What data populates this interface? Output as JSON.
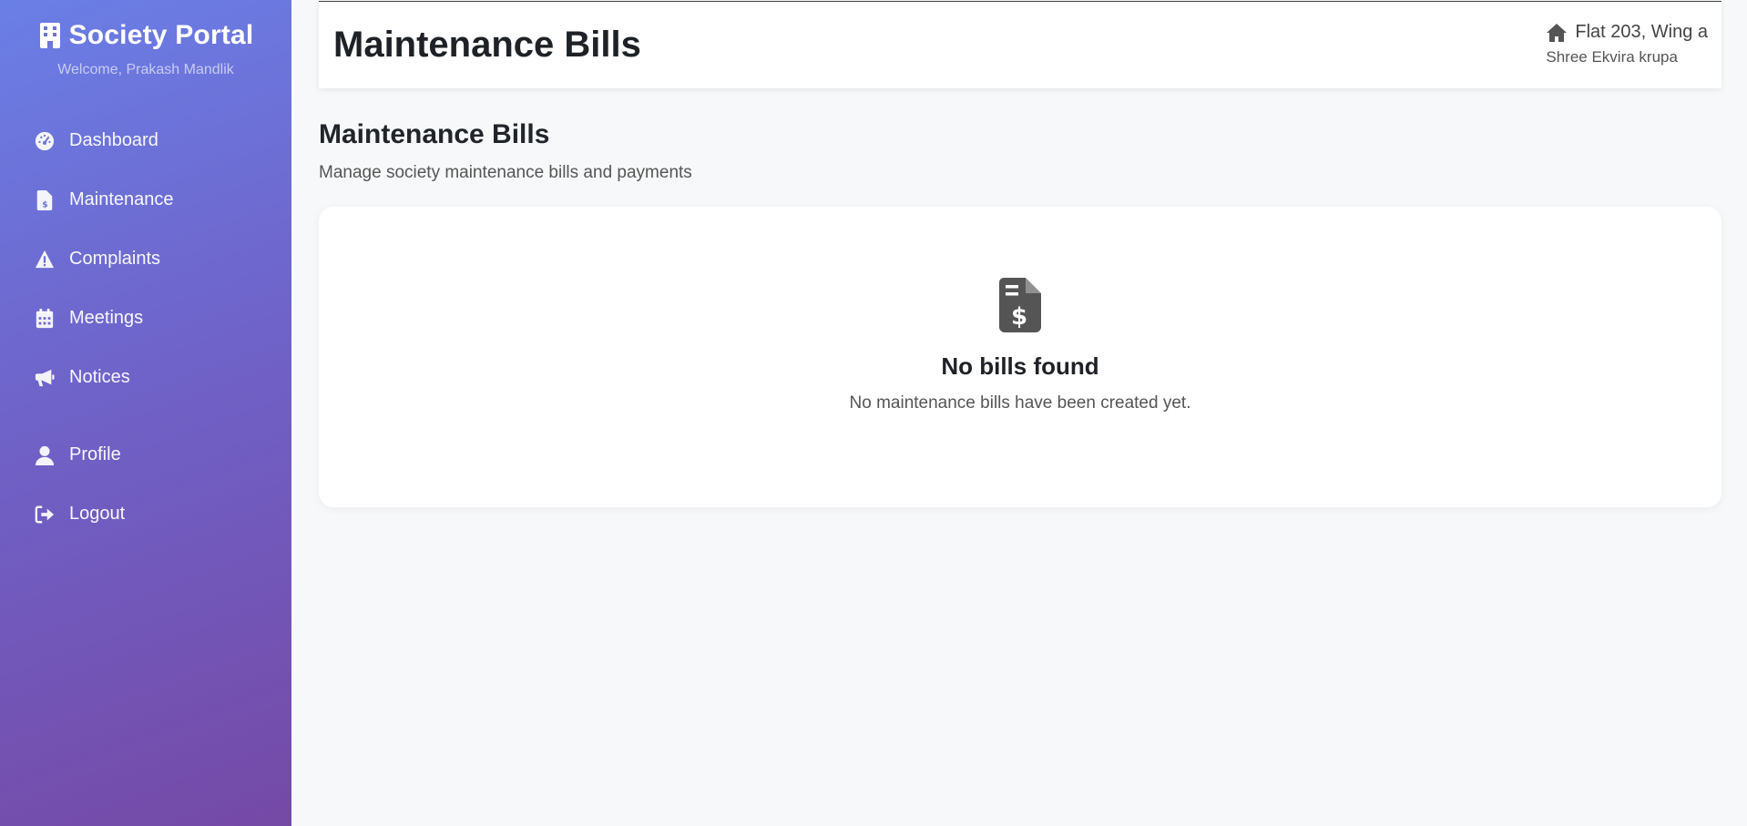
{
  "sidebar": {
    "brand": "Society Portal",
    "welcome": "Welcome, Prakash Mandlik",
    "items": [
      {
        "label": "Dashboard",
        "icon": "dashboard-icon"
      },
      {
        "label": "Maintenance",
        "icon": "bill-icon"
      },
      {
        "label": "Complaints",
        "icon": "warning-icon"
      },
      {
        "label": "Meetings",
        "icon": "calendar-icon"
      },
      {
        "label": "Notices",
        "icon": "megaphone-icon"
      }
    ],
    "bottom_items": [
      {
        "label": "Profile",
        "icon": "user-icon"
      },
      {
        "label": "Logout",
        "icon": "logout-icon"
      }
    ]
  },
  "header": {
    "title": "Maintenance Bills",
    "flat": "Flat 203, Wing a",
    "society": "Shree Ekvira krupa"
  },
  "main": {
    "title": "Maintenance Bills",
    "subtitle": "Manage society maintenance bills and payments",
    "empty_state": {
      "title": "No bills found",
      "text": "No maintenance bills have been created yet.",
      "icon": "invoice-dollar-icon"
    }
  },
  "colors": {
    "sidebar_gradient_start": "#6a7fe6",
    "sidebar_gradient_end": "#7549a6",
    "background": "#f7f8fa"
  }
}
